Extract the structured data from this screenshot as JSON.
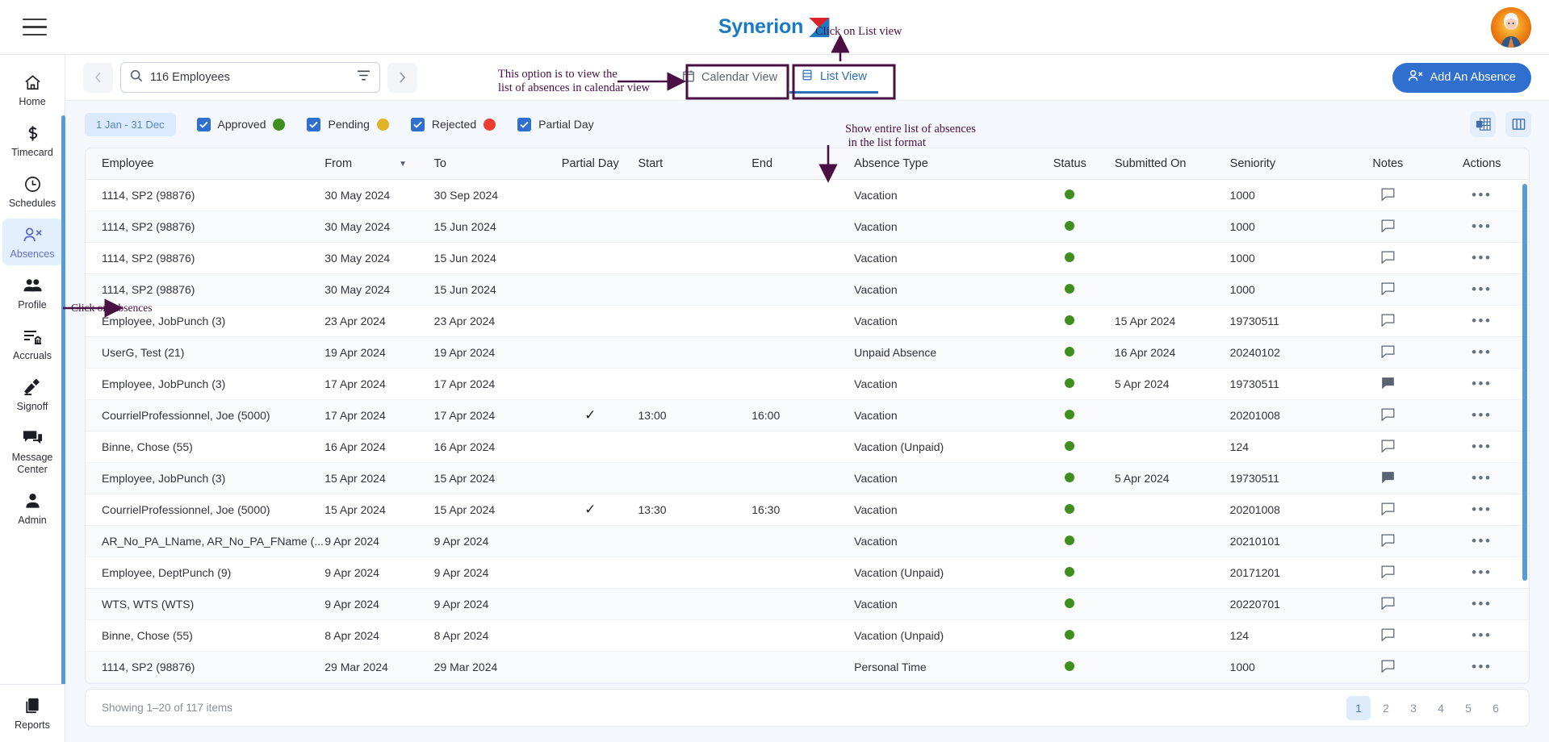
{
  "brand": {
    "name": "Synerion",
    "logo_icon": "synerion-logo-icon"
  },
  "topbar": {
    "menu_icon": "hamburger-menu-icon",
    "avatar_icon": "user-avatar-icon"
  },
  "sidebar": {
    "items": [
      {
        "label": "Home",
        "icon": "home-icon",
        "active": false
      },
      {
        "label": "Timecard",
        "icon": "dollar-icon",
        "active": false
      },
      {
        "label": "Schedules",
        "icon": "clock-icon",
        "active": false
      },
      {
        "label": "Absences",
        "icon": "person-remove-icon",
        "active": true
      },
      {
        "label": "Profile",
        "icon": "people-icon",
        "active": false
      },
      {
        "label": "Accruals",
        "icon": "list-bank-icon",
        "active": false
      },
      {
        "label": "Signoff",
        "icon": "signature-icon",
        "active": false
      },
      {
        "label": "Message Center",
        "icon": "chat-icon",
        "active": false
      },
      {
        "label": "Admin",
        "icon": "person-icon",
        "active": false
      }
    ],
    "bottom": {
      "label": "Reports",
      "icon": "copy-pages-icon"
    }
  },
  "search": {
    "value": "116 Employees",
    "placeholder": "116 Employees",
    "search_icon": "search-icon",
    "filter_icon": "filter-icon",
    "prev_icon": "chevron-left-icon",
    "next_icon": "chevron-right-icon"
  },
  "view_tabs": [
    {
      "label": "Calendar View",
      "icon": "calendar-icon",
      "active": false
    },
    {
      "label": "List View",
      "icon": "list-view-icon",
      "active": true
    }
  ],
  "add_button": {
    "label": "Add An Absence",
    "icon": "person-add-icon"
  },
  "filters": {
    "date_range": "1 Jan - 31 Dec",
    "legend": [
      {
        "label": "Approved",
        "checked": true,
        "color": "#3f8f1f"
      },
      {
        "label": "Pending",
        "checked": true,
        "color": "#e0b428"
      },
      {
        "label": "Rejected",
        "checked": true,
        "color": "#ef3c31"
      },
      {
        "label": "Partial Day",
        "checked": true,
        "color": null
      }
    ],
    "tools": [
      {
        "icon": "export-excel-icon"
      },
      {
        "icon": "column-settings-icon"
      }
    ]
  },
  "table": {
    "columns": [
      {
        "key": "employee",
        "label": "Employee",
        "sorted": false
      },
      {
        "key": "from",
        "label": "From",
        "sorted": true
      },
      {
        "key": "to",
        "label": "To",
        "sorted": false
      },
      {
        "key": "partial",
        "label": "Partial Day",
        "sorted": false
      },
      {
        "key": "start",
        "label": "Start",
        "sorted": false
      },
      {
        "key": "end",
        "label": "End",
        "sorted": false
      },
      {
        "key": "type",
        "label": "Absence Type",
        "sorted": false
      },
      {
        "key": "status",
        "label": "Status",
        "sorted": false
      },
      {
        "key": "submitted",
        "label": "Submitted On",
        "sorted": false
      },
      {
        "key": "seniority",
        "label": "Seniority",
        "sorted": false
      },
      {
        "key": "notes",
        "label": "Notes",
        "sorted": false
      },
      {
        "key": "actions",
        "label": "Actions",
        "sorted": false
      }
    ],
    "rows": [
      {
        "employee": "1114, SP2 (98876)",
        "from": "30 May 2024",
        "to": "30 Sep 2024",
        "partial": "",
        "start": "",
        "end": "",
        "type": "Vacation",
        "status_color": "#3f8f1f",
        "submitted": "",
        "seniority": "1000",
        "note_filled": false
      },
      {
        "employee": "1114, SP2 (98876)",
        "from": "30 May 2024",
        "to": "15 Jun 2024",
        "partial": "",
        "start": "",
        "end": "",
        "type": "Vacation",
        "status_color": "#3f8f1f",
        "submitted": "",
        "seniority": "1000",
        "note_filled": false
      },
      {
        "employee": "1114, SP2 (98876)",
        "from": "30 May 2024",
        "to": "15 Jun 2024",
        "partial": "",
        "start": "",
        "end": "",
        "type": "Vacation",
        "status_color": "#3f8f1f",
        "submitted": "",
        "seniority": "1000",
        "note_filled": false
      },
      {
        "employee": "1114, SP2 (98876)",
        "from": "30 May 2024",
        "to": "15 Jun 2024",
        "partial": "",
        "start": "",
        "end": "",
        "type": "Vacation",
        "status_color": "#3f8f1f",
        "submitted": "",
        "seniority": "1000",
        "note_filled": false
      },
      {
        "employee": "Employee, JobPunch (3)",
        "from": "23 Apr 2024",
        "to": "23 Apr 2024",
        "partial": "",
        "start": "",
        "end": "",
        "type": "Vacation",
        "status_color": "#3f8f1f",
        "submitted": "15 Apr 2024",
        "seniority": "19730511",
        "note_filled": false
      },
      {
        "employee": "UserG, Test (21)",
        "from": "19 Apr 2024",
        "to": "19 Apr 2024",
        "partial": "",
        "start": "",
        "end": "",
        "type": "Unpaid Absence",
        "status_color": "#3f8f1f",
        "submitted": "16 Apr 2024",
        "seniority": "20240102",
        "note_filled": false
      },
      {
        "employee": "Employee, JobPunch (3)",
        "from": "17 Apr 2024",
        "to": "17 Apr 2024",
        "partial": "",
        "start": "",
        "end": "",
        "type": "Vacation",
        "status_color": "#3f8f1f",
        "submitted": "5 Apr 2024",
        "seniority": "19730511",
        "note_filled": true
      },
      {
        "employee": "CourrielProfessionnel, Joe (5000)",
        "from": "17 Apr 2024",
        "to": "17 Apr 2024",
        "partial": "✓",
        "start": "13:00",
        "end": "16:00",
        "type": "Vacation",
        "status_color": "#3f8f1f",
        "submitted": "",
        "seniority": "20201008",
        "note_filled": false
      },
      {
        "employee": "Binne, Chose (55)",
        "from": "16 Apr 2024",
        "to": "16 Apr 2024",
        "partial": "",
        "start": "",
        "end": "",
        "type": "Vacation (Unpaid)",
        "status_color": "#3f8f1f",
        "submitted": "",
        "seniority": "124",
        "note_filled": false
      },
      {
        "employee": "Employee, JobPunch (3)",
        "from": "15 Apr 2024",
        "to": "15 Apr 2024",
        "partial": "",
        "start": "",
        "end": "",
        "type": "Vacation",
        "status_color": "#3f8f1f",
        "submitted": "5 Apr 2024",
        "seniority": "19730511",
        "note_filled": true
      },
      {
        "employee": "CourrielProfessionnel, Joe (5000)",
        "from": "15 Apr 2024",
        "to": "15 Apr 2024",
        "partial": "✓",
        "start": "13:30",
        "end": "16:30",
        "type": "Vacation",
        "status_color": "#3f8f1f",
        "submitted": "",
        "seniority": "20201008",
        "note_filled": false
      },
      {
        "employee": "AR_No_PA_LName, AR_No_PA_FName (...",
        "from": "9 Apr 2024",
        "to": "9 Apr 2024",
        "partial": "",
        "start": "",
        "end": "",
        "type": "Vacation",
        "status_color": "#3f8f1f",
        "submitted": "",
        "seniority": "20210101",
        "note_filled": false
      },
      {
        "employee": "Employee, DeptPunch (9)",
        "from": "9 Apr 2024",
        "to": "9 Apr 2024",
        "partial": "",
        "start": "",
        "end": "",
        "type": "Vacation (Unpaid)",
        "status_color": "#3f8f1f",
        "submitted": "",
        "seniority": "20171201",
        "note_filled": false
      },
      {
        "employee": "WTS, WTS (WTS)",
        "from": "9 Apr 2024",
        "to": "9 Apr 2024",
        "partial": "",
        "start": "",
        "end": "",
        "type": "Vacation",
        "status_color": "#3f8f1f",
        "submitted": "",
        "seniority": "20220701",
        "note_filled": false
      },
      {
        "employee": "Binne, Chose (55)",
        "from": "8 Apr 2024",
        "to": "8 Apr 2024",
        "partial": "",
        "start": "",
        "end": "",
        "type": "Vacation (Unpaid)",
        "status_color": "#3f8f1f",
        "submitted": "",
        "seniority": "124",
        "note_filled": false
      },
      {
        "employee": "1114, SP2 (98876)",
        "from": "29 Mar 2024",
        "to": "29 Mar 2024",
        "partial": "",
        "start": "",
        "end": "",
        "type": "Personal Time",
        "status_color": "#3f8f1f",
        "submitted": "",
        "seniority": "1000",
        "note_filled": false
      }
    ]
  },
  "footer": {
    "showing": "Showing 1–20 of 117 items",
    "pages": [
      "1",
      "2",
      "3",
      "4",
      "5",
      "6"
    ],
    "current_page": "1"
  },
  "annotations": [
    {
      "id": "a1",
      "text": "Click on List view"
    },
    {
      "id": "a2",
      "text": "This option is to view the\nlist of absences in calendar view"
    },
    {
      "id": "a3",
      "text": "Show entire list of absences\n in the list format"
    },
    {
      "id": "a4",
      "text": "Click on Absences"
    }
  ]
}
